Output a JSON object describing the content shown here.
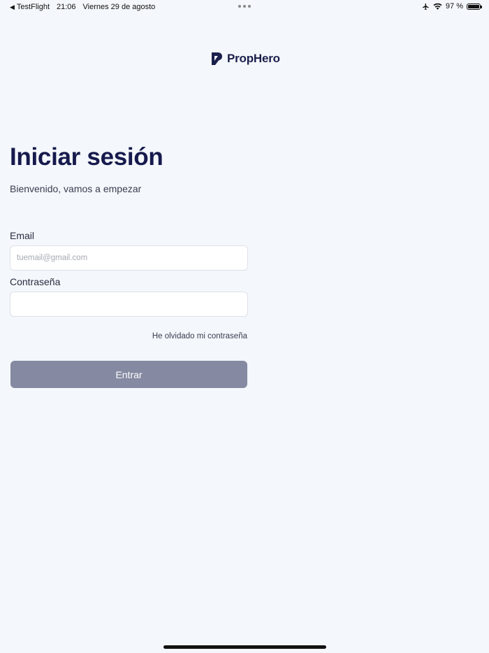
{
  "status_bar": {
    "back_app": "TestFlight",
    "time": "21:06",
    "date": "Viernes 29 de agosto",
    "battery": "97 %",
    "battery_level": 0.97,
    "icons": [
      "back-arrow-icon",
      "airplane-icon",
      "wifi-icon",
      "battery-icon"
    ]
  },
  "brand": {
    "name": "PropHero",
    "color": "#1b1f4b"
  },
  "login": {
    "title": "Iniciar sesión",
    "subtitle": "Bienvenido, vamos a empezar",
    "email_label": "Email",
    "email_placeholder": "tuemail@gmail.com",
    "email_value": "",
    "password_label": "Contraseña",
    "password_value": "",
    "forgot_password": "He olvidado mi contraseña",
    "submit_label": "Entrar",
    "submit_color": "#8589a1"
  }
}
